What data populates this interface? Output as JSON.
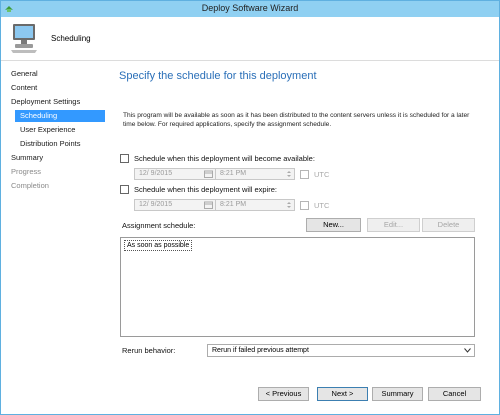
{
  "window": {
    "title": "Deploy Software Wizard"
  },
  "header": {
    "page_name": "Scheduling"
  },
  "sidebar": {
    "items": [
      {
        "label": "General",
        "state": "normal"
      },
      {
        "label": "Content",
        "state": "normal"
      },
      {
        "label": "Deployment Settings",
        "state": "normal"
      },
      {
        "label": "Scheduling",
        "state": "active"
      },
      {
        "label": "User Experience",
        "state": "normal"
      },
      {
        "label": "Distribution Points",
        "state": "normal"
      },
      {
        "label": "Summary",
        "state": "normal"
      },
      {
        "label": "Progress",
        "state": "disabled"
      },
      {
        "label": "Completion",
        "state": "disabled"
      }
    ]
  },
  "main": {
    "heading": "Specify the schedule for this deployment",
    "description": "This program will be available as soon as it has been distributed to the content servers unless it is scheduled for a later time below. For required applications, specify the assignment schedule.",
    "available": {
      "label": "Schedule when this deployment will become available:",
      "checked": false,
      "date": "12/ 9/2015",
      "time": "8:21 PM",
      "utc_label": "UTC"
    },
    "expire": {
      "label": "Schedule when this deployment will expire:",
      "checked": false,
      "date": "12/ 9/2015",
      "time": "8:21 PM",
      "utc_label": "UTC"
    },
    "assignment": {
      "label": "Assignment schedule:",
      "new_label": "New...",
      "edit_label": "Edit...",
      "delete_label": "Delete",
      "entries": [
        "As soon as possible"
      ]
    },
    "rerun": {
      "label": "Rerun behavior:",
      "value": "Rerun if failed previous attempt"
    }
  },
  "footer": {
    "previous_label": "< Previous",
    "next_label": "Next >",
    "summary_label": "Summary",
    "cancel_label": "Cancel"
  },
  "colors": {
    "titlebar": "#8fd0f2",
    "heading": "#2a6fb8",
    "selection": "#3399ff"
  }
}
